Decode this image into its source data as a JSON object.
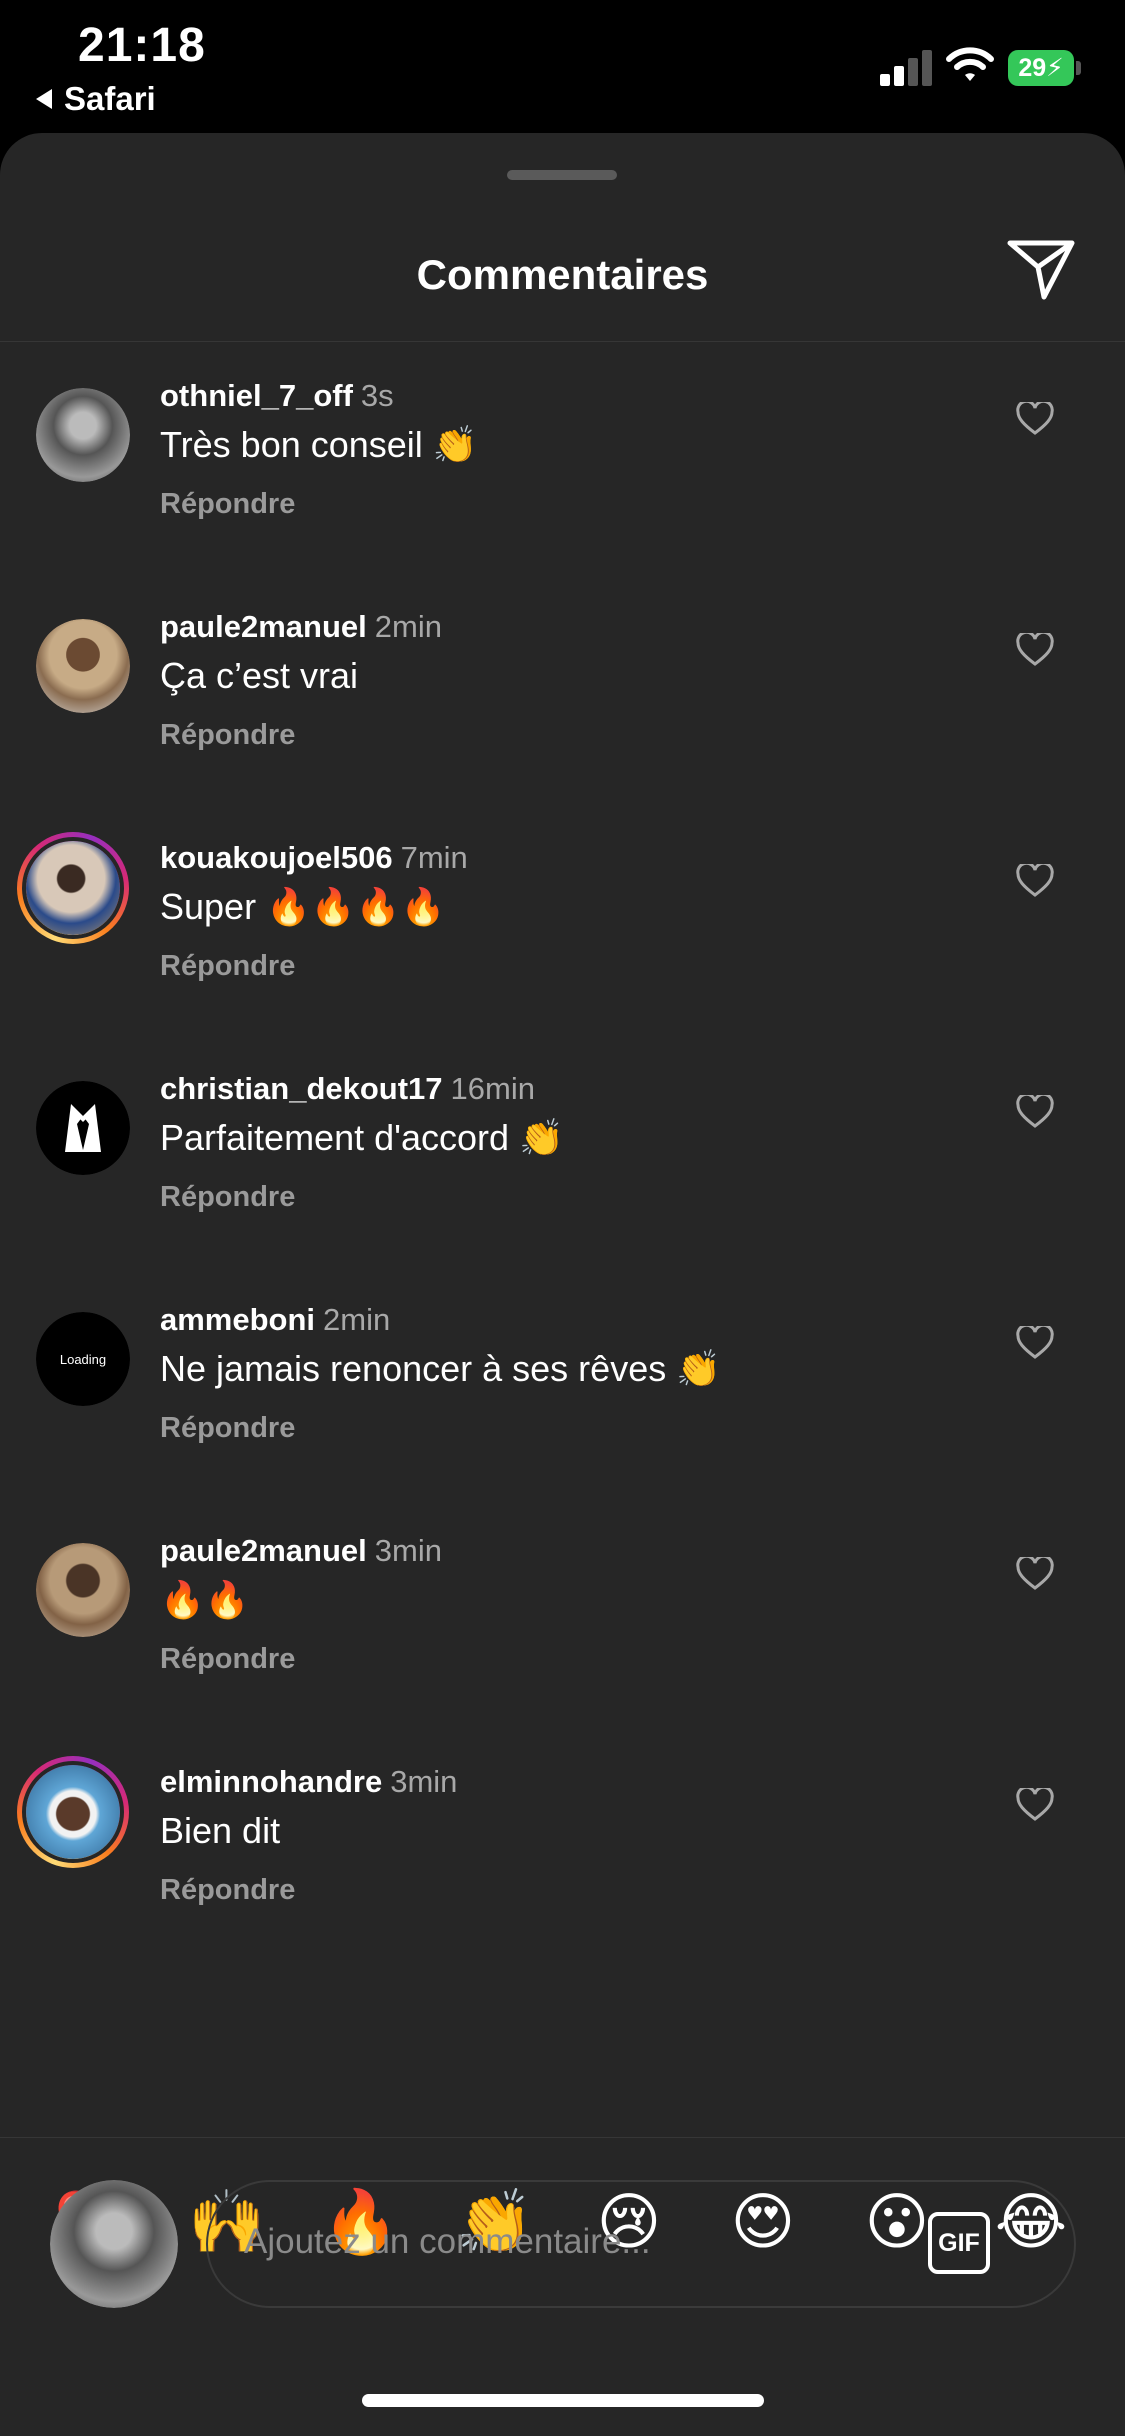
{
  "status_bar": {
    "time": "21:18",
    "back_label": "Safari",
    "battery": "29"
  },
  "sheet": {
    "title": "Commentaires"
  },
  "comments": [
    {
      "username": "othniel_7_off",
      "time": "3s",
      "text": "Très bon conseil 👏",
      "reply": "Répondre"
    },
    {
      "username": "paule2manuel",
      "time": "2min",
      "text": "Ça c’est vrai",
      "reply": "Répondre"
    },
    {
      "username": "kouakoujoel506",
      "time": "7min",
      "text": "Super 🔥🔥🔥🔥",
      "reply": "Répondre"
    },
    {
      "username": "christian_dekout17",
      "time": "16min",
      "text": "Parfaitement d'accord 👏",
      "reply": "Répondre"
    },
    {
      "username": "ammeboni",
      "time": "2min",
      "text": "Ne jamais renoncer à ses rêves 👏",
      "reply": "Répondre",
      "avatar_text": "Loading"
    },
    {
      "username": "paule2manuel",
      "time": "3min",
      "text": "🔥🔥",
      "reply": "Répondre"
    },
    {
      "username": "elminnohandre",
      "time": "3min",
      "text": "Bien dit",
      "reply": "Répondre"
    }
  ],
  "quick_reactions": [
    "❤️",
    "🙌",
    "🔥",
    "👏",
    "😢",
    "😍",
    "😮",
    "😂"
  ],
  "composer": {
    "placeholder": "Ajoutez un commentaire...",
    "gif_label": "GIF"
  },
  "icons": [
    "back-arrow-icon",
    "signal-icon",
    "wifi-icon",
    "battery-icon",
    "send-icon",
    "heart-outline-icon"
  ],
  "colors": {
    "background": "#262626",
    "battery": "#34c759",
    "secondary_text": "#a8a8a8"
  }
}
